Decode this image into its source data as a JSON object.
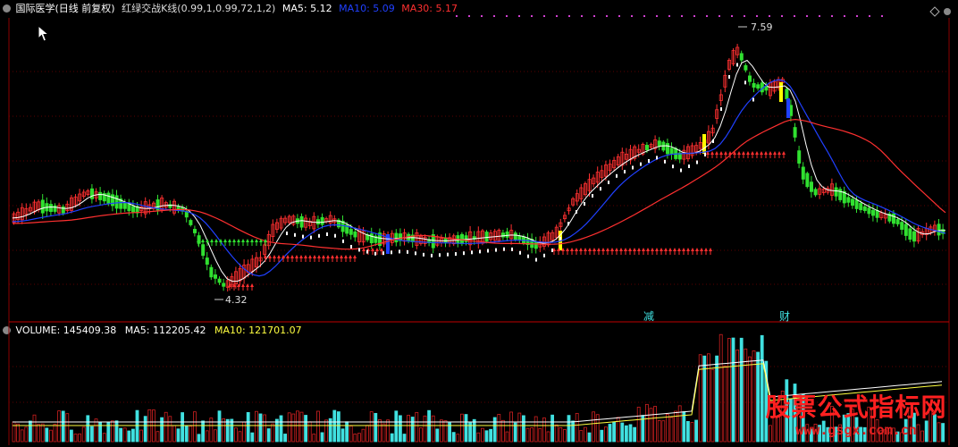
{
  "header": {
    "title": "国际医学(日线 前复权)",
    "indicator": "红绿交战K线(0.99,1,0.99,72,1,2)",
    "ma5": "MA5: 5.12",
    "ma10": "MA10: 5.09",
    "ma30": "MA30: 5.17"
  },
  "volume_header": {
    "volume": "VOLUME: 145409.38",
    "ma5": "MA5: 112205.42",
    "ma10": "MA10: 121701.07"
  },
  "annotations": {
    "high": "7.59",
    "low": "4.32",
    "label_jian": "减",
    "label_cai": "财"
  },
  "watermark": {
    "line1": "股票公式指标网",
    "line2": "www.gsgx.com.cn"
  },
  "colors": {
    "up": "#ff3030",
    "down": "#30e030",
    "ma5": "#ffffff",
    "ma10": "#2040ff",
    "ma30": "#ff3030",
    "grid": "#8b0000",
    "vol_up": "#d02020",
    "vol_down": "#40e0e0",
    "ma10_text": "#ffff40"
  }
}
